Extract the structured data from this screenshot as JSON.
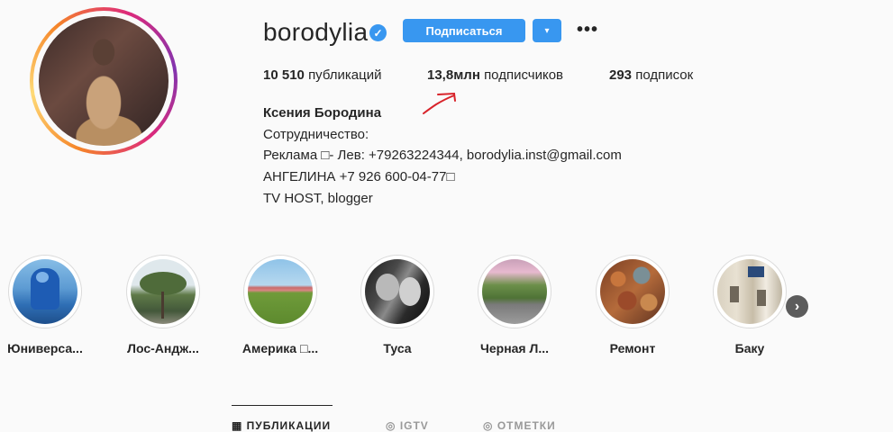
{
  "profile": {
    "username": "borodylia",
    "verified_icon": "verified-check-icon",
    "follow_label": "Подписаться",
    "dropdown_icon": "▾",
    "more_icon": "•••"
  },
  "stats": {
    "posts": "10 510",
    "posts_label": "публикаций",
    "followers": "13,8млн",
    "followers_label": "подписчиков",
    "following": "293",
    "following_label": "подписок"
  },
  "bio": {
    "full_name": "Ксения Бородина",
    "lines": [
      "Сотрудничество:",
      "Реклама □- Лев: +79263224344, borodylia.inst@gmail.com",
      "АНГЕЛИНА +7 926 600-04-77□",
      "TV HOST, blogger"
    ]
  },
  "highlights": [
    {
      "label": "Юниверса..."
    },
    {
      "label": "Лос-Андж..."
    },
    {
      "label": "Америка □..."
    },
    {
      "label": "Туса"
    },
    {
      "label": "Черная Л..."
    },
    {
      "label": "Ремонт"
    },
    {
      "label": "Баку"
    }
  ],
  "tabs": [
    {
      "label": "ПУБЛИКАЦИИ"
    },
    {
      "label": "IGTV"
    },
    {
      "label": "ОТМЕТКИ"
    }
  ],
  "colors": {
    "accent": "#3897f0",
    "annotation": "#d8232a"
  }
}
